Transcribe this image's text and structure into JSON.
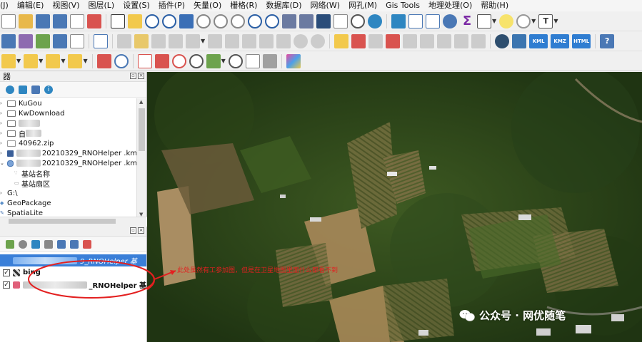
{
  "menu": {
    "items": [
      "(J)",
      "编辑(E)",
      "视图(V)",
      "图层(L)",
      "设置(S)",
      "插件(P)",
      "矢量(O)",
      "栅格(R)",
      "数据库(D)",
      "网络(W)",
      "网孔(M)",
      "Gis Tools",
      "地理处理(O)",
      "帮助(H)"
    ]
  },
  "toolbar": {
    "kml_label": "KML",
    "kmz_label": "KMZ",
    "html_label": "HTML",
    "sigma_label": "Σ",
    "text_label": "T",
    "help_label": "?"
  },
  "browser": {
    "title": "器",
    "items": [
      {
        "label": "KuGou"
      },
      {
        "label": "KwDownload"
      },
      {
        "label": ""
      },
      {
        "label": "自"
      },
      {
        "label": "40962.zip"
      },
      {
        "label": "20210329_RNOHelper .km"
      },
      {
        "label": "20210329_RNOHelper .km"
      },
      {
        "label": "基站名称"
      },
      {
        "label": "基站扇区"
      },
      {
        "label": "G:\\"
      },
      {
        "label": "GeoPackage"
      },
      {
        "label": "SpatiaLite"
      }
    ]
  },
  "layers": {
    "items": [
      {
        "label": "9_RNOHelper 基"
      },
      {
        "label": "bing"
      },
      {
        "label": "_RNOHelper 基"
      }
    ]
  },
  "annotation": {
    "text": "此处虽然有工参加图，但是在卫星地图里面什么都看不到"
  },
  "watermark": {
    "text": "公众号 · 网优随笔"
  },
  "colors": {
    "selection": "#3a7fd8",
    "annotation": "#e32020",
    "layer_swatch": "#e0607a"
  }
}
